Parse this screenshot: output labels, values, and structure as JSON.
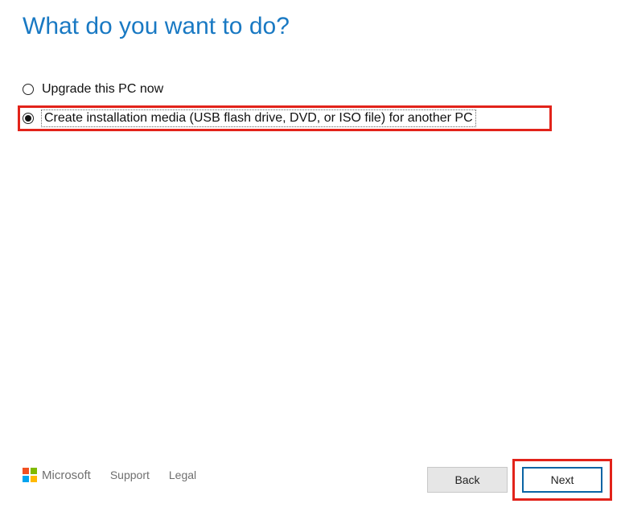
{
  "heading": "What do you want to do?",
  "options": [
    {
      "label": "Upgrade this PC now",
      "selected": false
    },
    {
      "label": "Create installation media (USB flash drive, DVD, or ISO file) for another PC",
      "selected": true
    }
  ],
  "footer": {
    "brand": "Microsoft",
    "links": [
      "Support",
      "Legal"
    ]
  },
  "buttons": {
    "back": "Back",
    "next": "Next"
  },
  "colors": {
    "accent": "#1979c3",
    "highlight": "#e2231a",
    "primaryBorder": "#0a64a4"
  }
}
